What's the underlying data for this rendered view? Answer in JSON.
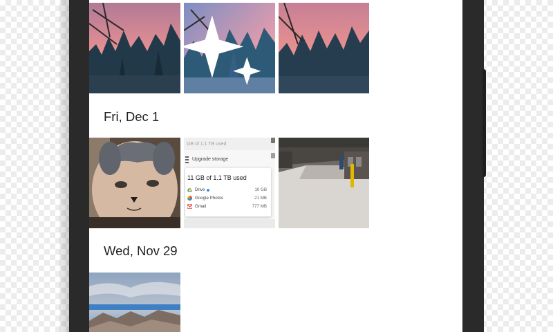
{
  "photos_app": {
    "sections": [
      {
        "date_label": ""
      },
      {
        "date_label": "Fri, Dec 1"
      },
      {
        "date_label": "Wed, Nov 29"
      }
    ],
    "tiles": [
      {
        "subject": "pine trees at sunset"
      },
      {
        "subject": "pine trees at sunset with auto-enhance sparkle"
      },
      {
        "subject": "pine trees at sunset"
      },
      {
        "subject": "gray and white cat"
      },
      {
        "subject": "storage screenshot"
      },
      {
        "subject": "snowy covered walkway"
      },
      {
        "subject": "mountains under cloudy sky"
      }
    ],
    "storage_screenshot": {
      "used_top": "GB of 1.1 TB used",
      "upgrade_label": "Upgrade storage",
      "card_title": "11 GB of 1.1 TB used",
      "rows": [
        {
          "label": "Drive",
          "size": "10 GB",
          "icon": "drive-icon"
        },
        {
          "label": "Google Photos",
          "size": "21 MB",
          "icon": "google-photos-icon"
        },
        {
          "label": "Gmail",
          "size": "777 MB",
          "icon": "gmail-icon"
        }
      ]
    },
    "icons": {
      "auto_enhance": "sparkle-icon"
    },
    "colors": {
      "sunset_pink": "#e58e97",
      "tree_dark": "#1f3a44",
      "frame": "#2a2a2a",
      "drive_blue": "#4285f4"
    }
  }
}
